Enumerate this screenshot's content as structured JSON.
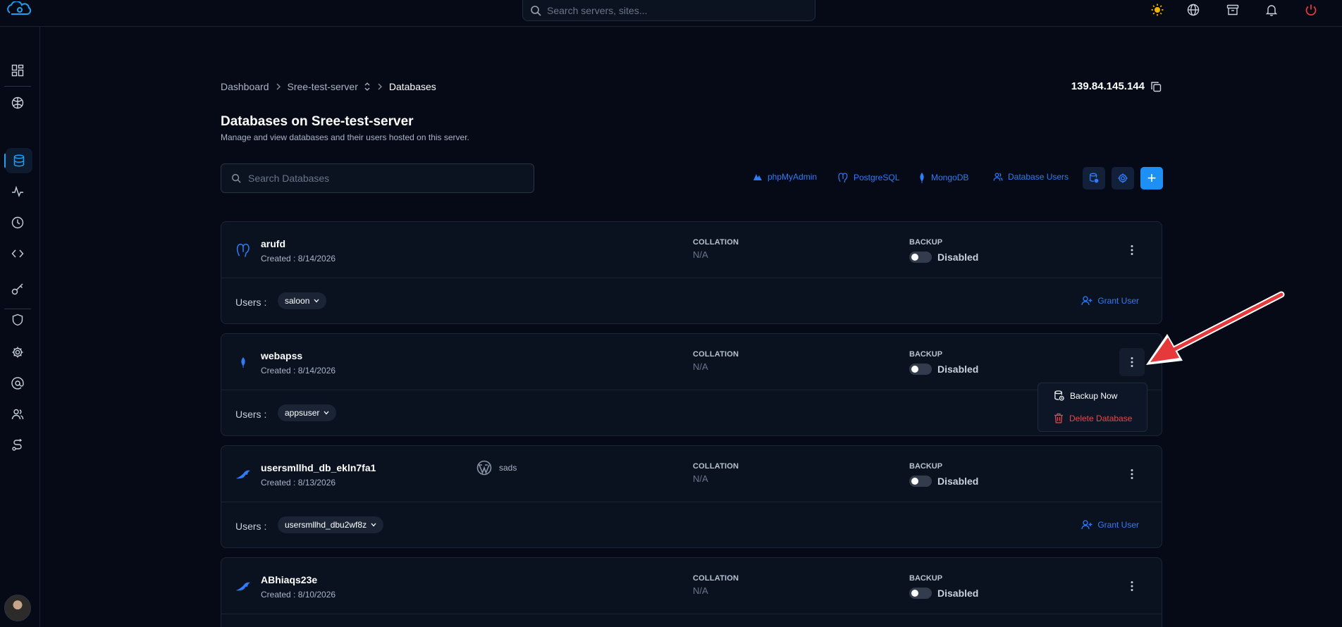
{
  "app": {
    "search_placeholder": "Search servers, sites...",
    "accent_color": "#1da1f2"
  },
  "topbar": {
    "icons": [
      "sun-icon",
      "globe-icon",
      "archive-icon",
      "bell-icon",
      "power-icon"
    ]
  },
  "sidebar": {
    "items": [
      "dashboard-icon",
      "server-icon",
      "database-icon",
      "activity-icon",
      "clock-icon",
      "code-icon",
      "key-icon",
      "shield-icon",
      "gear-icon",
      "at-icon",
      "users-icon",
      "route-icon"
    ],
    "active": "database-icon"
  },
  "breadcrumb": {
    "dashboard": "Dashboard",
    "server": "Sree-test-server",
    "current": "Databases"
  },
  "server_ip": "139.84.145.144",
  "page": {
    "title": "Databases on Sree-test-server",
    "subtitle": "Manage and view databases and their users hosted on this server."
  },
  "search": {
    "placeholder": "Search Databases"
  },
  "toolbar": {
    "phpmyadmin": "phpMyAdmin",
    "postgresql": "PostgreSQL",
    "mongodb": "MongoDB",
    "database_users": "Database Users",
    "add": "+"
  },
  "labels": {
    "collation": "COLLATION",
    "backup": "BACKUP",
    "users": "Users :",
    "grant_user": "Grant User"
  },
  "databases": [
    {
      "name": "arufd",
      "created": "Created : 8/14/2026",
      "engine_icon": "postgresql-icon",
      "collation": "N/A",
      "backup_state": "Disabled",
      "user": "saloon",
      "site": ""
    },
    {
      "name": "webapss",
      "created": "Created : 8/14/2026",
      "engine_icon": "mongodb-icon",
      "collation": "N/A",
      "backup_state": "Disabled",
      "user": "appsuser",
      "site": ""
    },
    {
      "name": "usersmllhd_db_ekln7fa1",
      "created": "Created : 8/13/2026",
      "engine_icon": "mysql-icon",
      "collation": "N/A",
      "backup_state": "Disabled",
      "user": "usersmllhd_dbu2wf8z",
      "site": "sads"
    },
    {
      "name": "ABhiaqs23e",
      "created": "Created : 8/10/2026",
      "engine_icon": "mysql-icon",
      "collation": "N/A",
      "backup_state": "Disabled",
      "user": "",
      "site": ""
    }
  ],
  "dropdown": {
    "backup_now": "Backup Now",
    "delete_database": "Delete Database"
  }
}
